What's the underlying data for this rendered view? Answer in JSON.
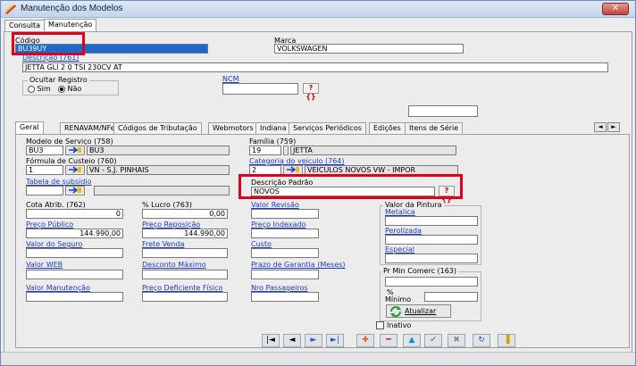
{
  "window": {
    "title": "Manutenção dos Modelos",
    "close_label": "✕"
  },
  "tabs": {
    "consulta": "Consulta",
    "manutencao": "Manutenção"
  },
  "codigo": {
    "label": "Código",
    "value": "BU39UY"
  },
  "marca": {
    "label": "Marca",
    "value": "VOLKSWAGEN"
  },
  "descricao": {
    "label": "Descrição (761)",
    "value": "JETTA GLI 2 0 TSI 230CV AT"
  },
  "ocultar": {
    "label": "Ocultar Registro",
    "sim": "Sim",
    "nao": "Não"
  },
  "ncm": {
    "label": "NCM",
    "value": "",
    "btn": "?{}"
  },
  "subtabs": [
    "Geral",
    "RENAVAM/NFe",
    "Códigos de Tributação",
    "Webmotors",
    "Indiana",
    "Serviços Periódicos",
    "Edições",
    "Itens de Série"
  ],
  "scroll_arrows": {
    "left": "◄",
    "right": "►"
  },
  "modelo_servico": {
    "label": "Modelo de Serviço (758)",
    "code": "BU3",
    "value": "BU3"
  },
  "familia": {
    "label": "Família (759)",
    "code": "19",
    "value": "JETTA"
  },
  "formula_custeio": {
    "label": "Fórmula de Custeio (760)",
    "code": "1",
    "value": "VN - S.J. PINHAIS"
  },
  "categoria": {
    "label": "Categoria do veículo (764)",
    "code": "2",
    "value": "VEICULOS NOVOS VW - IMPOR"
  },
  "tabela_subsidio": {
    "label": "Tabela de subsídio",
    "code": "",
    "value": ""
  },
  "descricao_padrao": {
    "label": "Descrição Padrão",
    "value": "NOVOS",
    "btn": "?{}"
  },
  "cota_atrib": {
    "label": "Cota Atrib. (762)",
    "value": "0"
  },
  "lucro": {
    "label": "% Lucro (763)",
    "value": "0,00"
  },
  "valor_revisao": {
    "label": "Valor Revisão",
    "value": ""
  },
  "preco_publico": {
    "label": "Preço Público",
    "value": "144.990,00"
  },
  "preco_reposicao": {
    "label": "Preço Reposição",
    "value": "144.990,00"
  },
  "preco_indexado": {
    "label": "Preço Indexado",
    "value": ""
  },
  "valor_seguro": {
    "label": "Valor do Seguro",
    "value": ""
  },
  "frete_venda": {
    "label": "Frete Venda",
    "value": ""
  },
  "custo": {
    "label": "Custo",
    "value": ""
  },
  "valor_web": {
    "label": "Valor WEB",
    "value": ""
  },
  "desconto_maximo": {
    "label": "Desconto Máximo",
    "value": ""
  },
  "prazo_garantia": {
    "label": "Prazo de Garantia (Meses)",
    "value": ""
  },
  "valor_manutencao": {
    "label": "Valor Manutenção",
    "value": ""
  },
  "preco_deficiente": {
    "label": "Preço Deficiente Físico",
    "value": ""
  },
  "nro_passageiros": {
    "label": "Nro Passageiros",
    "value": ""
  },
  "pintura": {
    "label": "Valor da Pintura",
    "metalica": "Metalica",
    "perolizada": "Perolizada",
    "especial": "Especial"
  },
  "pr_min": {
    "label": "Pr Min Comerc (163)",
    "pct": "%",
    "minimo": "Mínimo"
  },
  "atualizar": {
    "label": "Atualizar"
  },
  "inativo": {
    "label": "Inativo"
  },
  "nav": [
    "|◄",
    "◄",
    "►",
    "►|",
    "✚",
    "━",
    "▲",
    "✔",
    "✖",
    "↻",
    "▐"
  ],
  "colors": {
    "accent": "#1a3ccc",
    "highlight_border": "#e3001b",
    "selection": "#1c6acc"
  }
}
